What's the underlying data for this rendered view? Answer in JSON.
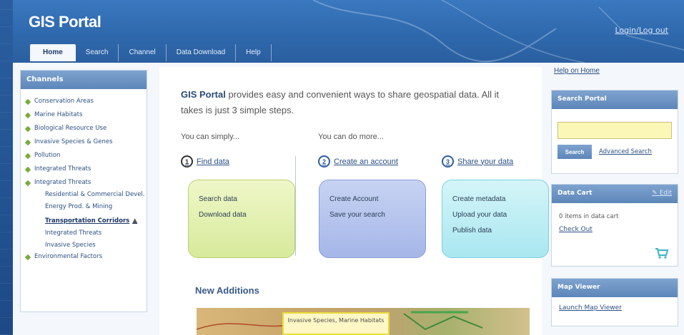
{
  "header": {
    "logo": "GIS Portal",
    "login": "Login/Log out",
    "tabs": [
      "Home",
      "Search",
      "Channel",
      "Data Download",
      "Help"
    ]
  },
  "sidebar": {
    "title": "Channels",
    "items": [
      "Conservation Areas",
      "Marine Habitats",
      "Biological Resource Use",
      "Invasive Species & Genes",
      "Pollution",
      "Integrated Threats",
      "Integrated Threats"
    ],
    "subitems": [
      "Residential & Commercial Devel.",
      "Energy Prod. & Mining",
      "Transportation Corridors",
      "Integrated Threats",
      "Invasive Species"
    ],
    "last_item": "Environmental Factors"
  },
  "main": {
    "intro_bold": "GIS Portal",
    "intro_rest": " provides easy and convenient ways to share geospatial data. All it takes is just 3 simple steps.",
    "col1_head": "You can simply...",
    "col2_head": "You can do more...",
    "steps": [
      {
        "num": "1",
        "label": "Find data"
      },
      {
        "num": "2",
        "label": "Create an account"
      },
      {
        "num": "3",
        "label": "Share your data"
      }
    ],
    "card1": [
      "Search data",
      "Download data"
    ],
    "card2": [
      "Create Account",
      "Save your search"
    ],
    "card3": [
      "Create metadata",
      "Upload your data",
      "Publish data"
    ],
    "new_additions": "New Additions",
    "map_caption": "Invasive Species, Marine Habitats"
  },
  "right": {
    "help": "Help on Home",
    "search_title": "Search Portal",
    "search_button": "Search",
    "advanced": "Advanced Search",
    "cart_title": "Data Cart",
    "cart_edit": "Edit",
    "cart_text": "0 items in data cart",
    "checkout": "Check Out",
    "map_title": "Map Viewer",
    "map_link": "Launch Map Viewer"
  },
  "colors": {
    "header": "#2f69ad",
    "panel_head": "#6a92c4",
    "card_green": "#dfeea9",
    "card_lavender": "#b4c2ec",
    "card_cyan": "#bdeef4"
  }
}
